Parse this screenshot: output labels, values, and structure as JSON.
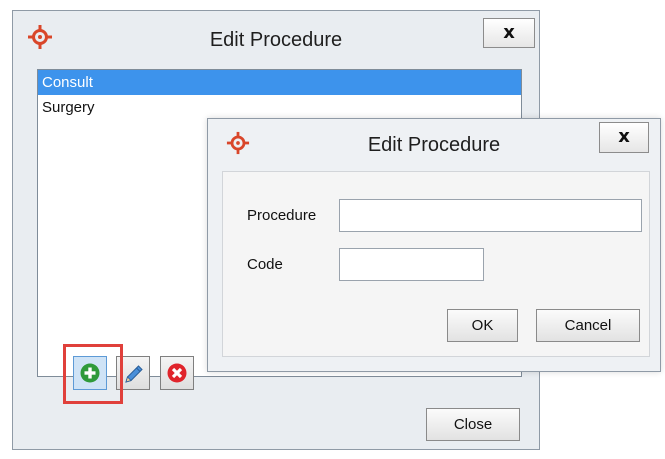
{
  "back_dialog": {
    "title": "Edit Procedure",
    "close_label": "x",
    "list": [
      "Consult",
      "Surgery"
    ],
    "selected_index": 0,
    "close_button_label": "Close"
  },
  "front_dialog": {
    "title": "Edit Procedure",
    "close_label": "x",
    "procedure_label": "Procedure",
    "procedure_value": "",
    "code_label": "Code",
    "code_value": "",
    "ok_label": "OK",
    "cancel_label": "Cancel"
  },
  "toolbar": {
    "add_icon": "add-circle-icon",
    "edit_icon": "pencil-icon",
    "delete_icon": "delete-circle-icon",
    "add_color": "#2e9a3a",
    "delete_color": "#e0242b"
  },
  "colors": {
    "selection": "#3d93ec",
    "highlight": "#e0403b",
    "app_icon": "#d9462a"
  }
}
